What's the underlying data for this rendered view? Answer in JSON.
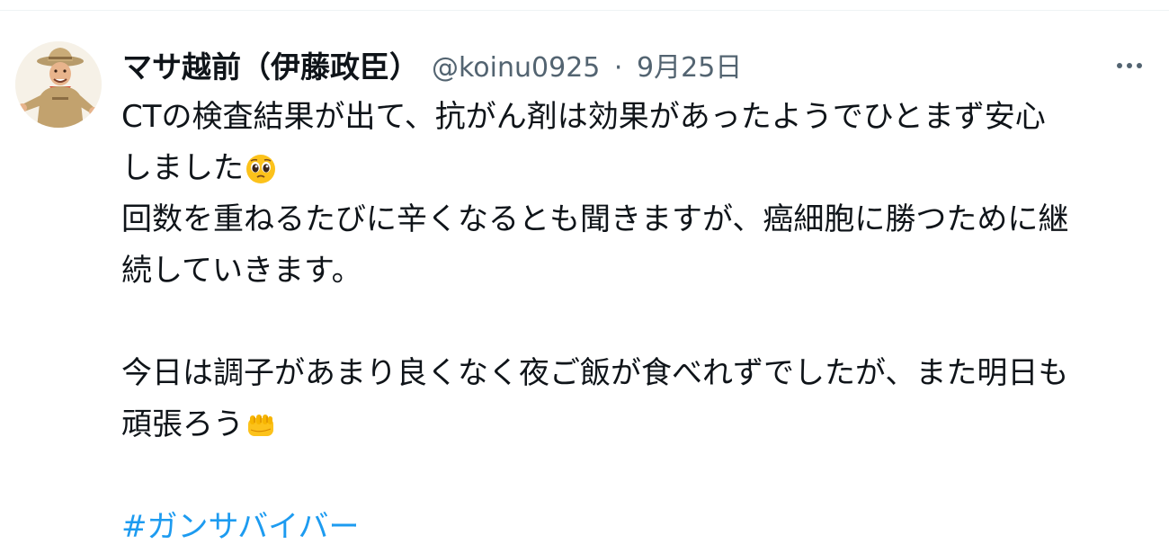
{
  "tweet": {
    "author": {
      "display_name": "マサ越前（伊藤政臣）",
      "handle": "@koinu0925",
      "separator": "·",
      "date": "9月25日",
      "avatar_icon": "user-avatar"
    },
    "more_icon": "more-options-icon",
    "text": {
      "line1": "CTの検査結果が出て、抗がん剤は効果があったようでひとまず安心",
      "line2": "しました",
      "line2_emoji": "pleading-face-emoji",
      "line3": "回数を重ねるたびに辛くなるとも聞きますが、癌細胞に勝つために継",
      "line4": "続していきます。",
      "line5": "今日は調子があまり良くなく夜ご飯が食べれずでしたが、また明日も",
      "line6": "頑張ろう",
      "line6_emoji": "oncoming-fist-emoji",
      "hashtag": "#ガンサバイバー"
    },
    "colors": {
      "text": "#0f1419",
      "secondary": "#536471",
      "link": "#1d9bf0",
      "divider": "#eff3f4"
    }
  }
}
